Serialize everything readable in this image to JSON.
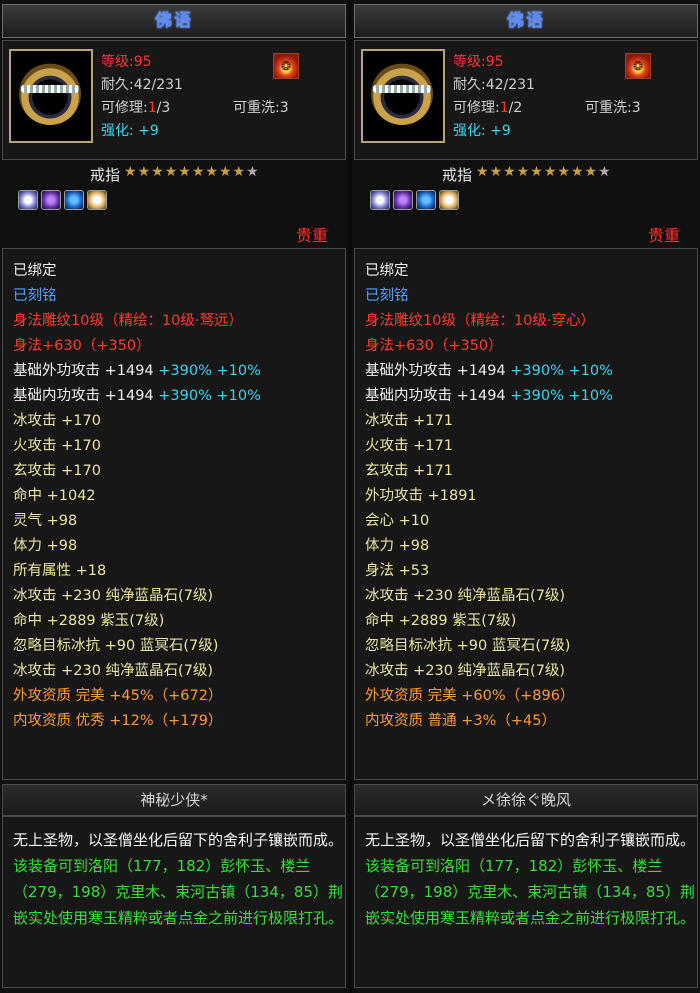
{
  "panels": [
    {
      "title": "佛语",
      "level_label": "等级:",
      "level_value": "95",
      "durability": "耐久:42/231",
      "repair_label": "可修理:",
      "repair_current": "1",
      "repair_max": "/3",
      "rewash": "可重洗:3",
      "enhance_label": "强化:",
      "enhance_value": "+9",
      "item_type": "戒指",
      "stars_filled": 9,
      "stars_total": 10,
      "quality": "贵重",
      "owner": "神秘少侠*",
      "attributes": [
        {
          "label": "已绑定",
          "value": "",
          "color": "white"
        },
        {
          "label": "已刻铭",
          "value": "",
          "color": "blue"
        },
        {
          "label": "身法雕纹10级（精绘：10级·驽远）",
          "value": "",
          "color": "red"
        },
        {
          "label": "身法+630（+350）",
          "value": "",
          "color": "red"
        },
        {
          "label": "基础外功攻击 +1494",
          "value": " +390% +10%",
          "color": "white",
          "value_color": "cyan"
        },
        {
          "label": "基础内功攻击 +1494",
          "value": " +390% +10%",
          "color": "white",
          "value_color": "cyan"
        },
        {
          "label": "冰攻击 +170",
          "value": "",
          "color": "yellow"
        },
        {
          "label": "火攻击 +170",
          "value": "",
          "color": "yellow"
        },
        {
          "label": "玄攻击 +170",
          "value": "",
          "color": "yellow"
        },
        {
          "label": "命中 +1042",
          "value": "",
          "color": "yellow"
        },
        {
          "label": "灵气 +98",
          "value": "",
          "color": "yellow"
        },
        {
          "label": "体力 +98",
          "value": "",
          "color": "yellow"
        },
        {
          "label": "所有属性 +18",
          "value": "",
          "color": "yellow"
        },
        {
          "label": "冰攻击 +230 纯净蓝晶石(7级)",
          "value": "",
          "color": "yellow"
        },
        {
          "label": "命中 +2889 紫玉(7级)",
          "value": "",
          "color": "yellow"
        },
        {
          "label": "忽略目标冰抗 +90 蓝冥石(7级)",
          "value": "",
          "color": "yellow"
        },
        {
          "label": "冰攻击 +230 纯净蓝晶石(7级)",
          "value": "",
          "color": "yellow"
        },
        {
          "label": "外攻资质  完美 +45%（+672）",
          "value": "",
          "color": "orange"
        },
        {
          "label": "内攻资质  优秀 +12%（+179）",
          "value": "",
          "color": "orange"
        }
      ],
      "desc_intro": "无上圣物，以圣僧坐化后留下的舍利子镶嵌而成。",
      "desc_hint": "该装备可到洛阳（177，182）彭怀玉、楼兰（279，198）克里木、束河古镇（134，85）荆嵌实处使用寒玉精粹或者点金之前进行极限打孔。"
    },
    {
      "title": "佛语",
      "level_label": "等级:",
      "level_value": "95",
      "durability": "耐久:42/231",
      "repair_label": "可修理:",
      "repair_current": "1",
      "repair_max": "/2",
      "rewash": "可重洗:3",
      "enhance_label": "强化:",
      "enhance_value": "+9",
      "item_type": "戒指",
      "stars_filled": 9,
      "stars_total": 10,
      "quality": "贵重",
      "owner": "メ徐徐ぐ晚风",
      "attributes": [
        {
          "label": "已绑定",
          "value": "",
          "color": "white"
        },
        {
          "label": "已刻铭",
          "value": "",
          "color": "blue"
        },
        {
          "label": "身法雕纹10级（精绘：10级·穿心）",
          "value": "",
          "color": "red"
        },
        {
          "label": "身法+630（+350）",
          "value": "",
          "color": "red"
        },
        {
          "label": "基础外功攻击 +1494",
          "value": " +390% +10%",
          "color": "white",
          "value_color": "cyan"
        },
        {
          "label": "基础内功攻击 +1494",
          "value": " +390% +10%",
          "color": "white",
          "value_color": "cyan"
        },
        {
          "label": "冰攻击 +171",
          "value": "",
          "color": "yellow"
        },
        {
          "label": "火攻击 +171",
          "value": "",
          "color": "yellow"
        },
        {
          "label": "玄攻击 +171",
          "value": "",
          "color": "yellow"
        },
        {
          "label": "外功攻击 +1891",
          "value": "",
          "color": "yellow"
        },
        {
          "label": "会心 +10",
          "value": "",
          "color": "yellow"
        },
        {
          "label": "体力 +98",
          "value": "",
          "color": "yellow"
        },
        {
          "label": "身法 +53",
          "value": "",
          "color": "yellow"
        },
        {
          "label": "冰攻击 +230 纯净蓝晶石(7级)",
          "value": "",
          "color": "yellow"
        },
        {
          "label": "命中 +2889 紫玉(7级)",
          "value": "",
          "color": "yellow"
        },
        {
          "label": "忽略目标冰抗 +90 蓝冥石(7级)",
          "value": "",
          "color": "yellow"
        },
        {
          "label": "冰攻击 +230 纯净蓝晶石(7级)",
          "value": "",
          "color": "yellow"
        },
        {
          "label": "外攻资质  完美 +60%（+896）",
          "value": "",
          "color": "orange"
        },
        {
          "label": "内攻资质  普通 +3%（+45）",
          "value": "",
          "color": "orange"
        }
      ],
      "desc_intro": "无上圣物，以圣僧坐化后留下的舍利子镶嵌而成。",
      "desc_hint": "该装备可到洛阳（177，182）彭怀玉、楼兰（279，198）克里木、束河古镇（134，85）荆嵌实处使用寒玉精粹或者点金之前进行极限打孔。"
    }
  ],
  "gem_icons": [
    "diamond-gem-icon",
    "amethyst-gem-icon",
    "sapphire-gem-icon",
    "pearl-gem-icon"
  ],
  "colors": {
    "title": "#5b8dff",
    "red": "#ff3030",
    "cyan": "#35d6f0",
    "gold_star": "#c9a040",
    "green_text": "#36e036"
  }
}
